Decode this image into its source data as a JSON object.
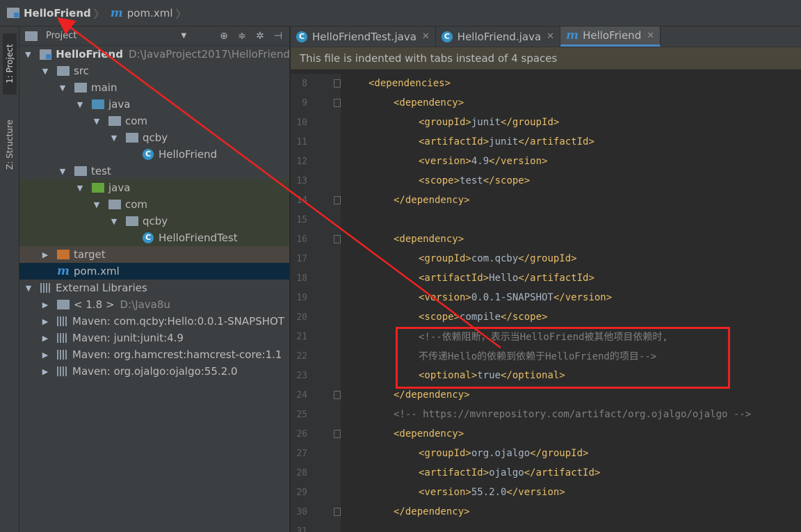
{
  "breadcrumb": {
    "project": "HelloFriend",
    "file": "pom.xml",
    "file_icon": "m"
  },
  "toolwindows": {
    "project_tab": "1: Project",
    "structure_tab": "Z: Structure"
  },
  "project_panel": {
    "title": "Project",
    "tree": [
      {
        "label": "HelloFriend",
        "path": "D:\\JavaProject2017\\HelloFriend",
        "bold": true
      },
      {
        "label": "src"
      },
      {
        "label": "main"
      },
      {
        "label": "java"
      },
      {
        "label": "com"
      },
      {
        "label": "qcby"
      },
      {
        "label": "HelloFriend",
        "icon": "C"
      },
      {
        "label": "test"
      },
      {
        "label": "java"
      },
      {
        "label": "com"
      },
      {
        "label": "qcby"
      },
      {
        "label": "HelloFriendTest",
        "icon": "C"
      },
      {
        "label": "target"
      },
      {
        "label": "pom.xml",
        "icon": "m"
      },
      {
        "label": "External Libraries"
      },
      {
        "label": "< 1.8 >",
        "path": "D:\\Java8u"
      },
      {
        "label": "Maven: com.qcby:Hello:0.0.1-SNAPSHOT"
      },
      {
        "label": "Maven: junit:junit:4.9"
      },
      {
        "label": "Maven: org.hamcrest:hamcrest-core:1.1"
      },
      {
        "label": "Maven: org.ojalgo:ojalgo:55.2.0"
      }
    ]
  },
  "tabs": [
    {
      "label": "HelloFriendTest.java",
      "icon": "C"
    },
    {
      "label": "HelloFriend.java",
      "icon": "C"
    },
    {
      "label": "HelloFriend",
      "icon": "m",
      "active": true
    }
  ],
  "banner": "This file is indented with tabs instead of 4 spaces",
  "code_lines": [
    {
      "num": "8",
      "text": "<dependencies>",
      "kind": "tag"
    },
    {
      "num": "9",
      "text": "<dependency>",
      "kind": "tag"
    },
    {
      "num": "10",
      "text": "<groupId>junit</groupId>",
      "kind": "elem"
    },
    {
      "num": "11",
      "text": "<artifactId>junit</artifactId>",
      "kind": "elem"
    },
    {
      "num": "12",
      "text": "<version>4.9</version>",
      "kind": "elem"
    },
    {
      "num": "13",
      "text": "<scope>test</scope>",
      "kind": "elem"
    },
    {
      "num": "14",
      "text": "</dependency>",
      "kind": "tag"
    },
    {
      "num": "15",
      "text": "",
      "kind": "blank"
    },
    {
      "num": "16",
      "text": "<dependency>",
      "kind": "tag"
    },
    {
      "num": "17",
      "text": "<groupId>com.qcby</groupId>",
      "kind": "elem"
    },
    {
      "num": "18",
      "text": "<artifactId>Hello</artifactId>",
      "kind": "elem"
    },
    {
      "num": "19",
      "text": "<version>0.0.1-SNAPSHOT</version>",
      "kind": "elem"
    },
    {
      "num": "20",
      "text": "<scope>compile</scope>",
      "kind": "elem"
    },
    {
      "num": "21",
      "text": "<!--依赖阻断，表示当HelloFriend被其他项目依赖时,",
      "kind": "comment"
    },
    {
      "num": "22",
      "text": "不传递Hello的依赖到依赖于HelloFriend的项目-->",
      "kind": "comment"
    },
    {
      "num": "23",
      "text": "<optional>true</optional>",
      "kind": "elem"
    },
    {
      "num": "24",
      "text": "</dependency>",
      "kind": "tag"
    },
    {
      "num": "25",
      "text": "<!-- https://mvnrepository.com/artifact/org.ojalgo/ojalgo -->",
      "kind": "comment"
    },
    {
      "num": "26",
      "text": "<dependency>",
      "kind": "tag"
    },
    {
      "num": "27",
      "text": "<groupId>org.ojalgo</groupId>",
      "kind": "elem"
    },
    {
      "num": "28",
      "text": "<artifactId>ojalgo</artifactId>",
      "kind": "elem"
    },
    {
      "num": "29",
      "text": "<version>55.2.0</version>",
      "kind": "elem"
    },
    {
      "num": "30",
      "text": "</dependency>",
      "kind": "tag"
    },
    {
      "num": "31",
      "text": "",
      "kind": "blank"
    }
  ],
  "colors": {
    "annotation": "#ee2222",
    "xml_tag": "#e8bf6a",
    "comment": "#808080",
    "text": "#a9b7c6"
  }
}
